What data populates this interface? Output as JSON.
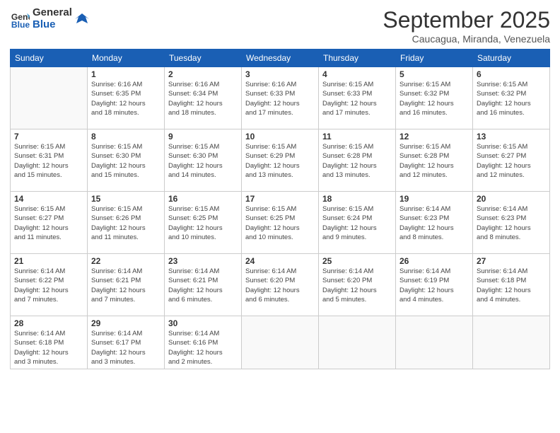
{
  "logo": {
    "line1": "General",
    "line2": "Blue"
  },
  "title": "September 2025",
  "subtitle": "Caucagua, Miranda, Venezuela",
  "weekdays": [
    "Sunday",
    "Monday",
    "Tuesday",
    "Wednesday",
    "Thursday",
    "Friday",
    "Saturday"
  ],
  "weeks": [
    [
      {
        "day": "",
        "info": ""
      },
      {
        "day": "1",
        "info": "Sunrise: 6:16 AM\nSunset: 6:35 PM\nDaylight: 12 hours\nand 18 minutes."
      },
      {
        "day": "2",
        "info": "Sunrise: 6:16 AM\nSunset: 6:34 PM\nDaylight: 12 hours\nand 18 minutes."
      },
      {
        "day": "3",
        "info": "Sunrise: 6:16 AM\nSunset: 6:33 PM\nDaylight: 12 hours\nand 17 minutes."
      },
      {
        "day": "4",
        "info": "Sunrise: 6:15 AM\nSunset: 6:33 PM\nDaylight: 12 hours\nand 17 minutes."
      },
      {
        "day": "5",
        "info": "Sunrise: 6:15 AM\nSunset: 6:32 PM\nDaylight: 12 hours\nand 16 minutes."
      },
      {
        "day": "6",
        "info": "Sunrise: 6:15 AM\nSunset: 6:32 PM\nDaylight: 12 hours\nand 16 minutes."
      }
    ],
    [
      {
        "day": "7",
        "info": "Sunrise: 6:15 AM\nSunset: 6:31 PM\nDaylight: 12 hours\nand 15 minutes."
      },
      {
        "day": "8",
        "info": "Sunrise: 6:15 AM\nSunset: 6:30 PM\nDaylight: 12 hours\nand 15 minutes."
      },
      {
        "day": "9",
        "info": "Sunrise: 6:15 AM\nSunset: 6:30 PM\nDaylight: 12 hours\nand 14 minutes."
      },
      {
        "day": "10",
        "info": "Sunrise: 6:15 AM\nSunset: 6:29 PM\nDaylight: 12 hours\nand 13 minutes."
      },
      {
        "day": "11",
        "info": "Sunrise: 6:15 AM\nSunset: 6:28 PM\nDaylight: 12 hours\nand 13 minutes."
      },
      {
        "day": "12",
        "info": "Sunrise: 6:15 AM\nSunset: 6:28 PM\nDaylight: 12 hours\nand 12 minutes."
      },
      {
        "day": "13",
        "info": "Sunrise: 6:15 AM\nSunset: 6:27 PM\nDaylight: 12 hours\nand 12 minutes."
      }
    ],
    [
      {
        "day": "14",
        "info": "Sunrise: 6:15 AM\nSunset: 6:27 PM\nDaylight: 12 hours\nand 11 minutes."
      },
      {
        "day": "15",
        "info": "Sunrise: 6:15 AM\nSunset: 6:26 PM\nDaylight: 12 hours\nand 11 minutes."
      },
      {
        "day": "16",
        "info": "Sunrise: 6:15 AM\nSunset: 6:25 PM\nDaylight: 12 hours\nand 10 minutes."
      },
      {
        "day": "17",
        "info": "Sunrise: 6:15 AM\nSunset: 6:25 PM\nDaylight: 12 hours\nand 10 minutes."
      },
      {
        "day": "18",
        "info": "Sunrise: 6:15 AM\nSunset: 6:24 PM\nDaylight: 12 hours\nand 9 minutes."
      },
      {
        "day": "19",
        "info": "Sunrise: 6:14 AM\nSunset: 6:23 PM\nDaylight: 12 hours\nand 8 minutes."
      },
      {
        "day": "20",
        "info": "Sunrise: 6:14 AM\nSunset: 6:23 PM\nDaylight: 12 hours\nand 8 minutes."
      }
    ],
    [
      {
        "day": "21",
        "info": "Sunrise: 6:14 AM\nSunset: 6:22 PM\nDaylight: 12 hours\nand 7 minutes."
      },
      {
        "day": "22",
        "info": "Sunrise: 6:14 AM\nSunset: 6:21 PM\nDaylight: 12 hours\nand 7 minutes."
      },
      {
        "day": "23",
        "info": "Sunrise: 6:14 AM\nSunset: 6:21 PM\nDaylight: 12 hours\nand 6 minutes."
      },
      {
        "day": "24",
        "info": "Sunrise: 6:14 AM\nSunset: 6:20 PM\nDaylight: 12 hours\nand 6 minutes."
      },
      {
        "day": "25",
        "info": "Sunrise: 6:14 AM\nSunset: 6:20 PM\nDaylight: 12 hours\nand 5 minutes."
      },
      {
        "day": "26",
        "info": "Sunrise: 6:14 AM\nSunset: 6:19 PM\nDaylight: 12 hours\nand 4 minutes."
      },
      {
        "day": "27",
        "info": "Sunrise: 6:14 AM\nSunset: 6:18 PM\nDaylight: 12 hours\nand 4 minutes."
      }
    ],
    [
      {
        "day": "28",
        "info": "Sunrise: 6:14 AM\nSunset: 6:18 PM\nDaylight: 12 hours\nand 3 minutes."
      },
      {
        "day": "29",
        "info": "Sunrise: 6:14 AM\nSunset: 6:17 PM\nDaylight: 12 hours\nand 3 minutes."
      },
      {
        "day": "30",
        "info": "Sunrise: 6:14 AM\nSunset: 6:16 PM\nDaylight: 12 hours\nand 2 minutes."
      },
      {
        "day": "",
        "info": ""
      },
      {
        "day": "",
        "info": ""
      },
      {
        "day": "",
        "info": ""
      },
      {
        "day": "",
        "info": ""
      }
    ]
  ]
}
